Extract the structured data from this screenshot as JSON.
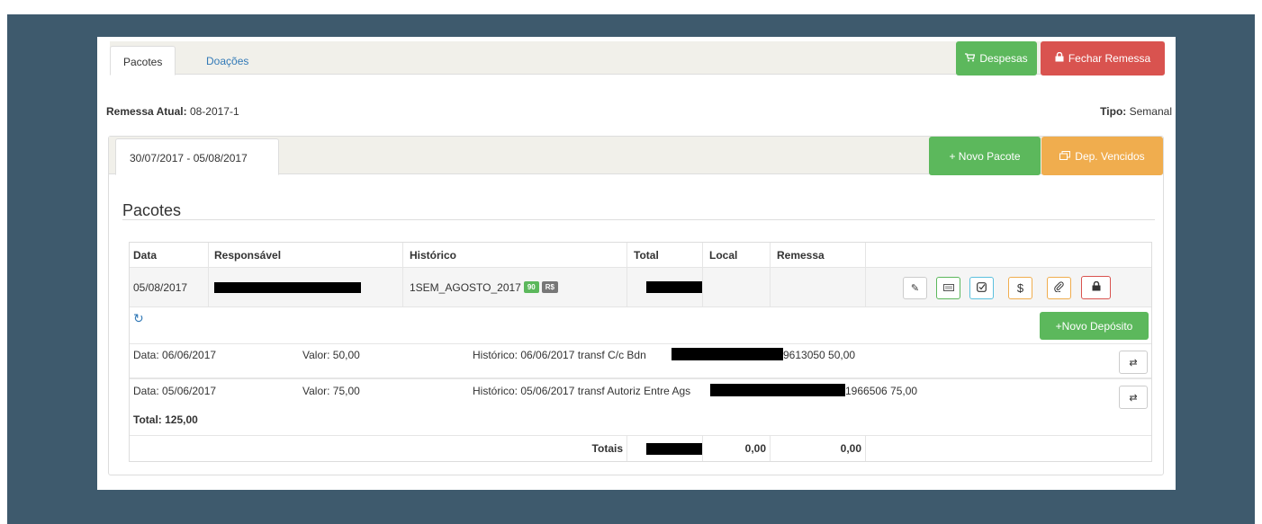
{
  "tabs": {
    "pacotes": "Pacotes",
    "doacoes": "Doações"
  },
  "actions": {
    "despesas": "Despesas",
    "fechar_remessa": "Fechar Remessa"
  },
  "remessa": {
    "label": "Remessa Atual:",
    "value": "08-2017-1"
  },
  "tipo": {
    "label": "Tipo:",
    "value": "Semanal"
  },
  "period_tab": "30/07/2017 - 05/08/2017",
  "period_actions": {
    "novo_pacote": "+ Novo Pacote",
    "dep_vencidos": "Dep. Vencidos"
  },
  "section_title": "Pacotes",
  "table": {
    "headers": [
      "Data",
      "Responsável",
      "Histórico",
      "Total",
      "Local",
      "Remessa"
    ],
    "row": {
      "data": "05/08/2017",
      "historico": "1SEM_AGOSTO_2017",
      "badge_count": "90",
      "badge_currency": "R$"
    }
  },
  "novo_deposito": "+Novo Depósito",
  "deposits": [
    {
      "data": "Data: 06/06/2017",
      "valor": "Valor: 50,00",
      "historico": "Histórico: 06/06/2017 transf C/c Bdn",
      "tail": "9613050 50,00"
    },
    {
      "data": "Data: 05/06/2017",
      "valor": "Valor: 75,00",
      "historico": "Histórico: 05/06/2017 transf Autoriz Entre Ags",
      "tail": "1966506 75,00"
    }
  ],
  "deposit_total": "Total: 125,00",
  "totals": {
    "label": "Totais",
    "local": "0,00",
    "remessa": "0,00"
  },
  "colors": {
    "green": "#5cb85c",
    "red": "#d9534f",
    "orange": "#f0ad4e",
    "blue": "#5bc0de",
    "frame": "#3e5a6d"
  }
}
